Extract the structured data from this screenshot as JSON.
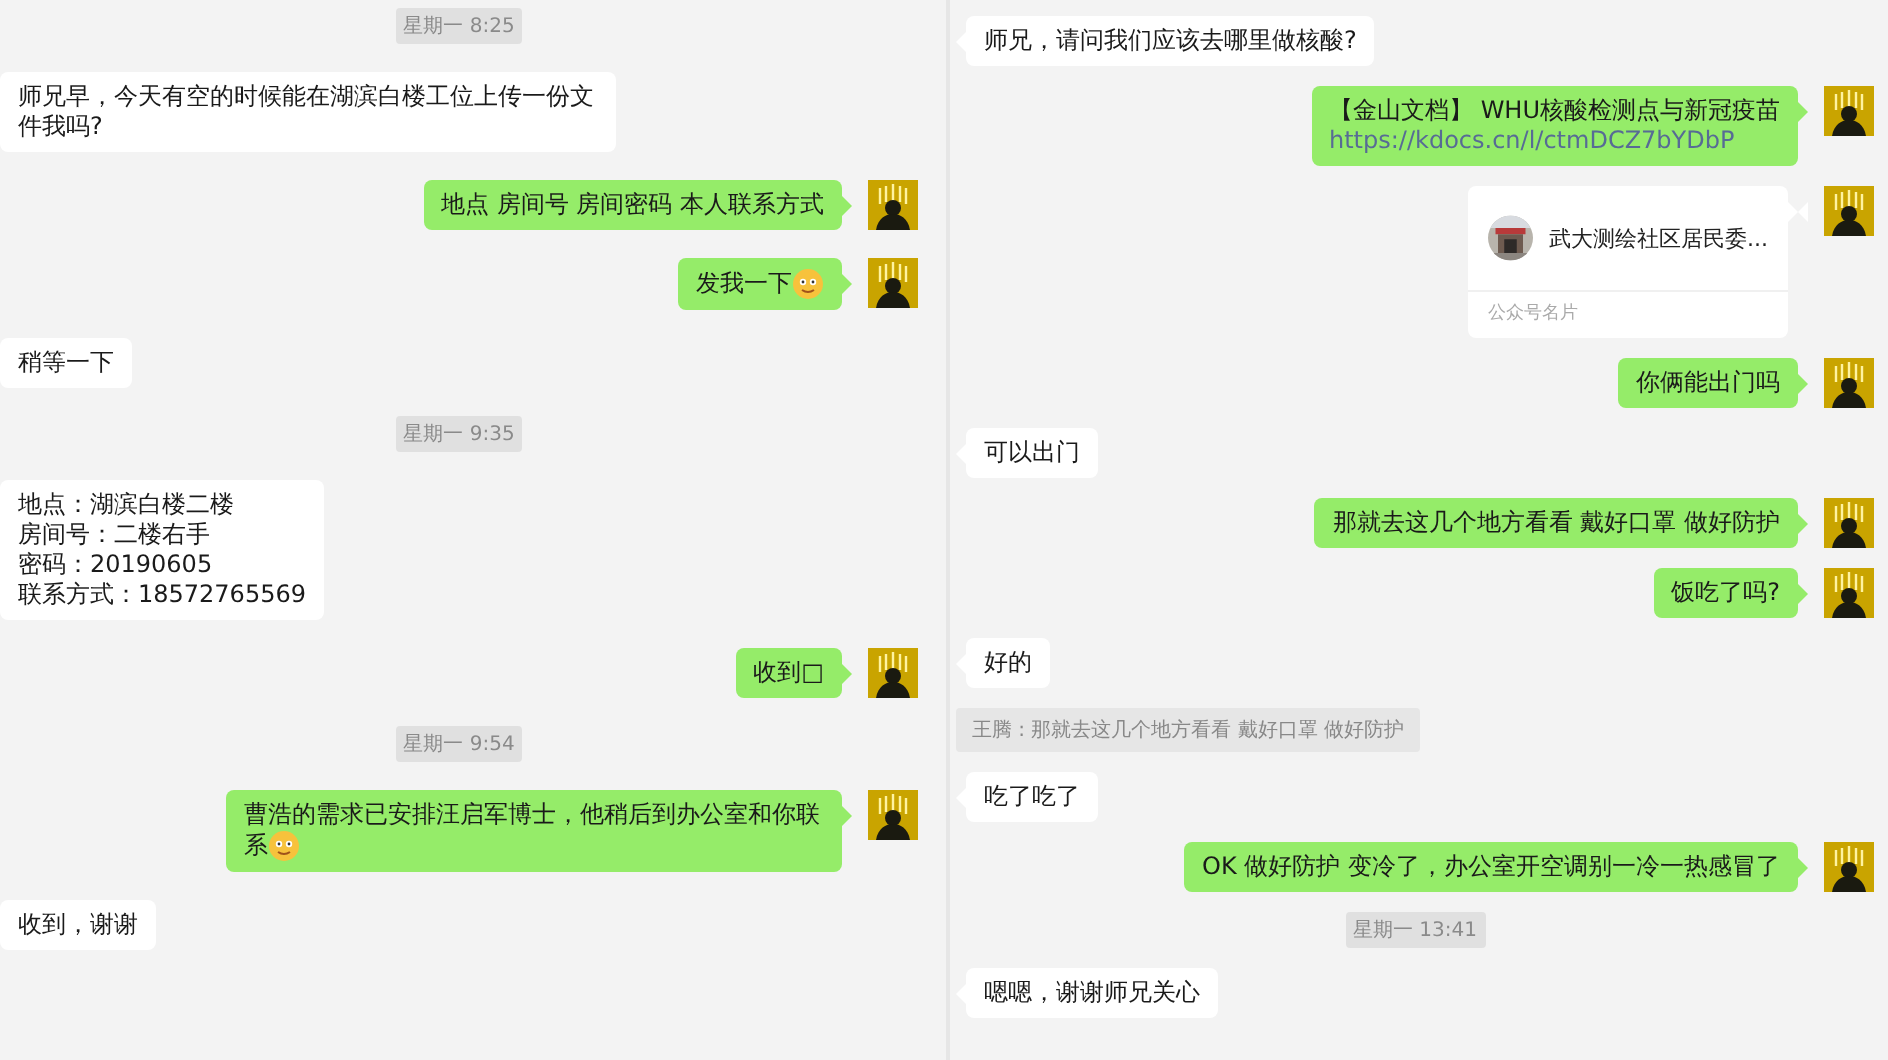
{
  "panes": [
    {
      "messages": [
        {
          "kind": "time",
          "text": "星期一 8:25"
        },
        {
          "kind": "in",
          "text": "师兄早，今天有空的时候能在湖滨白楼工位上传一份文件我吗?"
        },
        {
          "kind": "out",
          "text": "地点 房间号 房间密码 本人联系方式",
          "emoji": false
        },
        {
          "kind": "out",
          "text": "发我一下",
          "emoji": true
        },
        {
          "kind": "in",
          "text": "稍等一下"
        },
        {
          "kind": "time",
          "text": "星期一 9:35"
        },
        {
          "kind": "in",
          "lines": [
            "地点：湖滨白楼二楼",
            "房间号：二楼右手",
            "密码：20190605",
            "联系方式：18572765569"
          ]
        },
        {
          "kind": "out",
          "text": "收到□",
          "emoji": false
        },
        {
          "kind": "time",
          "text": "星期一 9:54"
        },
        {
          "kind": "out",
          "text": "曹浩的需求已安排汪启军博士，他稍后到办公室和你联系",
          "emoji": true
        },
        {
          "kind": "in",
          "text": "收到，谢谢"
        }
      ]
    },
    {
      "messages": [
        {
          "kind": "in",
          "text": "师兄，请问我们应该去哪里做核酸?"
        },
        {
          "kind": "link",
          "text": "【金山文档】 WHU核酸检测点与新冠疫苗",
          "url": "https://kdocs.cn/l/ctmDCZ7bYDbP"
        },
        {
          "kind": "card",
          "text": "武大测绘社区居民委...",
          "footer": "公众号名片"
        },
        {
          "kind": "out",
          "text": "你俩能出门吗",
          "emoji": false
        },
        {
          "kind": "in",
          "text": "可以出门"
        },
        {
          "kind": "out",
          "text": "那就去这几个地方看看 戴好口罩 做好防护",
          "emoji": false
        },
        {
          "kind": "out",
          "text": "饭吃了吗?",
          "emoji": false
        },
        {
          "kind": "in",
          "text": "好的"
        },
        {
          "kind": "quote",
          "text": "王腾 : 那就去这几个地方看看 戴好口罩 做好防护"
        },
        {
          "kind": "in",
          "text": "吃了吃了"
        },
        {
          "kind": "out",
          "text": "OK 做好防护 变冷了，办公室开空调别一冷一热感冒了",
          "emoji": false
        },
        {
          "kind": "time",
          "text": "星期一 13:41"
        },
        {
          "kind": "in",
          "text": "嗯嗯，谢谢师兄关心"
        }
      ]
    }
  ]
}
